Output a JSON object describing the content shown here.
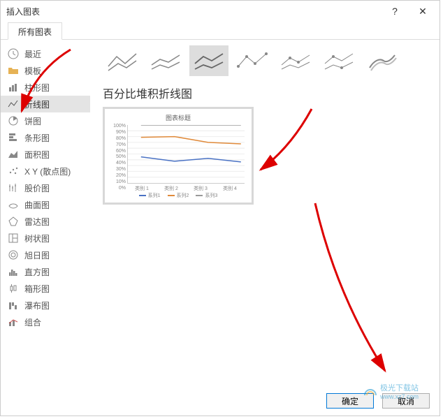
{
  "dialog": {
    "title": "插入图表",
    "help_label": "?",
    "close_label": "✕"
  },
  "tab": {
    "label": "所有图表"
  },
  "sidebar": {
    "items": [
      {
        "label": "最近"
      },
      {
        "label": "模板"
      },
      {
        "label": "柱形图"
      },
      {
        "label": "折线图"
      },
      {
        "label": "饼图"
      },
      {
        "label": "条形图"
      },
      {
        "label": "面积图"
      },
      {
        "label": "X Y (散点图)"
      },
      {
        "label": "股价图"
      },
      {
        "label": "曲面图"
      },
      {
        "label": "雷达图"
      },
      {
        "label": "树状图"
      },
      {
        "label": "旭日图"
      },
      {
        "label": "直方图"
      },
      {
        "label": "箱形图"
      },
      {
        "label": "瀑布图"
      },
      {
        "label": "组合"
      }
    ]
  },
  "main": {
    "selected_chart_title": "百分比堆积折线图"
  },
  "preview": {
    "title": "图表标题",
    "legend": [
      "系列1",
      "系列2",
      "系列3"
    ],
    "categories": [
      "类别 1",
      "类别 2",
      "类别 3",
      "类别 4"
    ]
  },
  "chart_data": {
    "type": "line",
    "title": "图表标题",
    "xlabel": "",
    "ylabel": "",
    "ylim": [
      0,
      100
    ],
    "yticks": [
      "100%",
      "90%",
      "80%",
      "70%",
      "60%",
      "50%",
      "40%",
      "30%",
      "20%",
      "10%",
      "0%"
    ],
    "categories": [
      "类别 1",
      "类别 2",
      "类别 3",
      "类别 4"
    ],
    "series": [
      {
        "name": "系列1",
        "color": "#4a72c4",
        "values": [
          45,
          38,
          43,
          36
        ]
      },
      {
        "name": "系列2",
        "color": "#e08a3a",
        "values": [
          78,
          80,
          70,
          68
        ]
      },
      {
        "name": "系列3",
        "color": "#999999",
        "values": [
          100,
          100,
          100,
          100
        ]
      }
    ]
  },
  "footer": {
    "ok": "确定",
    "cancel": "取消"
  },
  "watermark": {
    "line1": "极光下载站",
    "line2": "www.xz7.com"
  }
}
